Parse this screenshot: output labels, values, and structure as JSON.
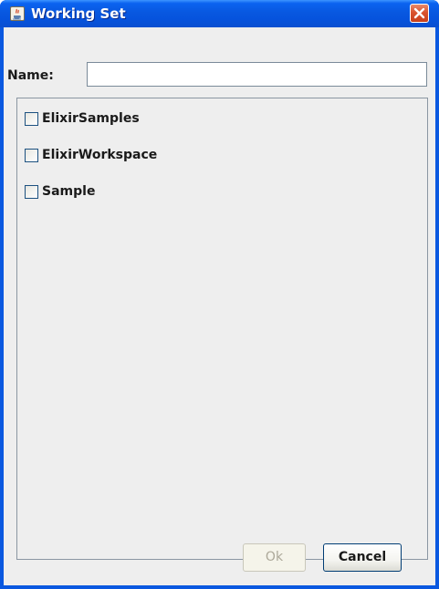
{
  "window": {
    "title": "Working Set",
    "icon": "java-cup-icon",
    "close_icon": "close-icon"
  },
  "form": {
    "name_label": "Name:",
    "name_value": "",
    "name_placeholder": ""
  },
  "list": {
    "items": [
      {
        "label": "ElixirSamples",
        "checked": false
      },
      {
        "label": "ElixirWorkspace",
        "checked": false
      },
      {
        "label": "Sample",
        "checked": false
      }
    ]
  },
  "buttons": {
    "ok_label": "Ok",
    "ok_enabled": false,
    "cancel_label": "Cancel"
  },
  "colors": {
    "titlebar": "#0858e0",
    "close_button": "#d9532f",
    "dialog_background": "#eeeeee"
  }
}
